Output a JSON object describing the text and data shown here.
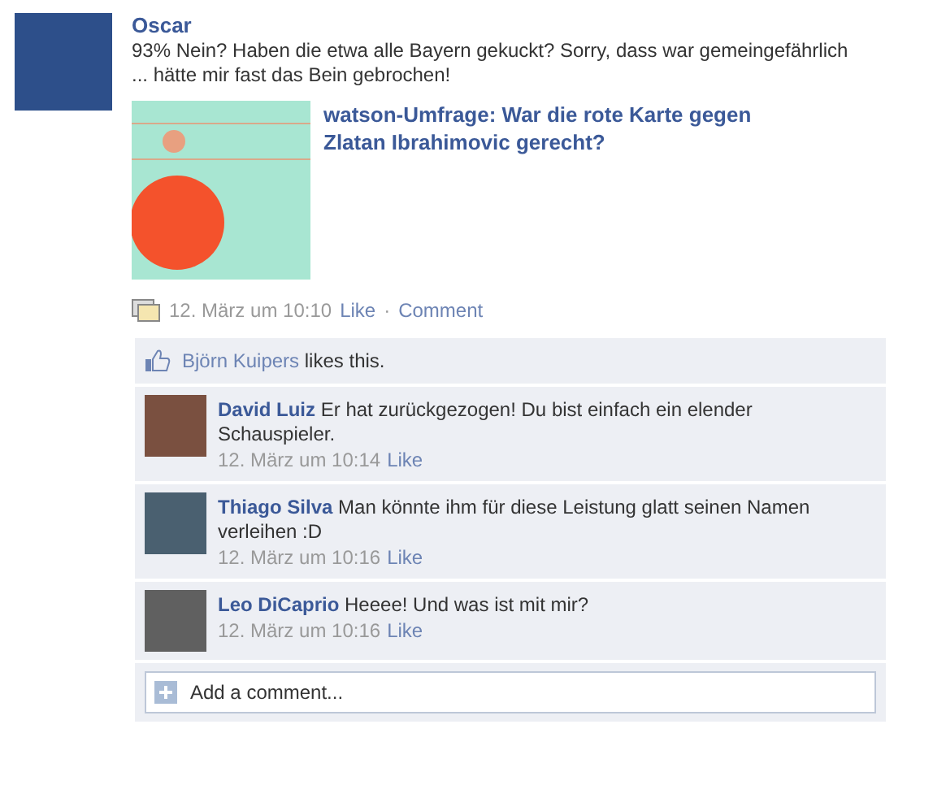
{
  "post": {
    "author": "Oscar",
    "text": "93% Nein? Haben die etwa alle Bayern gekuckt? Sorry, dass war gemeingefährlich ... hätte mir fast das Bein gebrochen!",
    "attachment": {
      "title": "watson-Umfrage: War die rote Karte gegen Zlatan Ibrahimovic gerecht?"
    },
    "time": "12. März um 10:10",
    "actions": [
      "Like",
      "Comment"
    ],
    "separator": "·"
  },
  "likes": {
    "name": "Björn Kuipers",
    "text": "likes this."
  },
  "comments": [
    {
      "author": "David Luiz",
      "text": "Er hat zurückgezogen! Du bist einfach ein elender Schauspieler.",
      "time": "12. März um 10:14",
      "action": "Like"
    },
    {
      "author": "Thiago Silva",
      "text": "Man könnte ihm für diese Leistung glatt seinen Namen verleihen :D",
      "time": "12. März um 10:16",
      "action": "Like"
    },
    {
      "author": "Leo DiCaprio",
      "text": "Heeee! Und was ist mit mir?",
      "time": "12. März um 10:16",
      "action": "Like"
    }
  ],
  "comment_field": {
    "placeholder": "Add a comment..."
  }
}
